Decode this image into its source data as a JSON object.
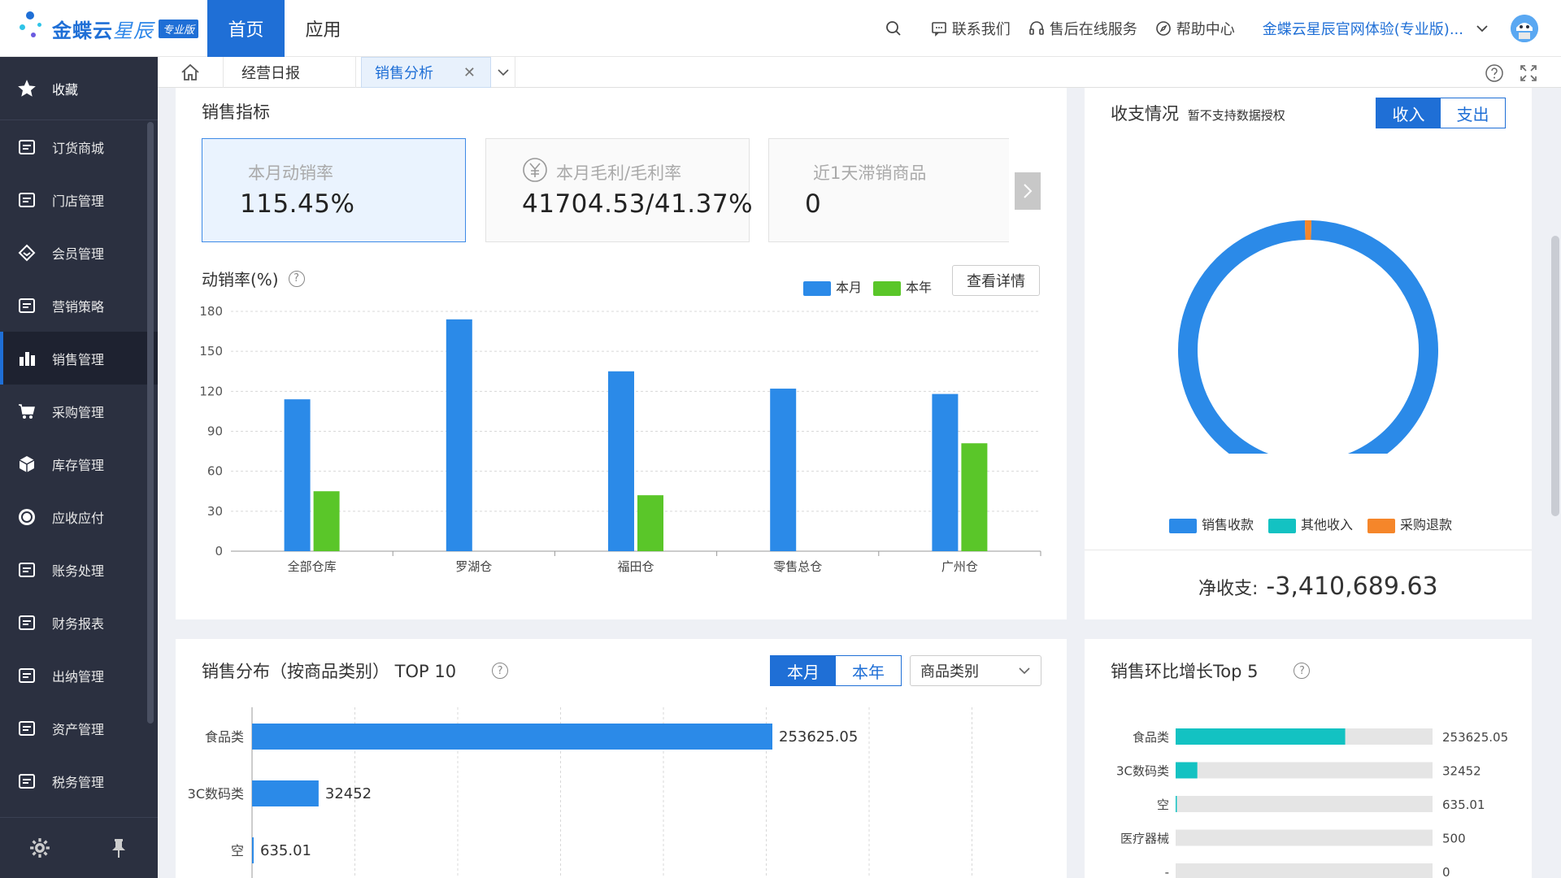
{
  "topbar": {
    "brand_text": "金蝶云",
    "brand_star": "星辰",
    "brand_badge": "专业版",
    "nav": [
      {
        "label": "首页"
      },
      {
        "label": "应用"
      }
    ],
    "contact": "联系我们",
    "after_sales": "售后在线服务",
    "help_center": "帮助中心",
    "account": "金蝶云星辰官网体验(专业版)..."
  },
  "sidebar": {
    "favorites": "收藏",
    "items": [
      {
        "label": "订货商城",
        "icon": "cart-bag-icon"
      },
      {
        "label": "门店管理",
        "icon": "store-icon"
      },
      {
        "label": "会员管理",
        "icon": "diamond-icon"
      },
      {
        "label": "营销策略",
        "icon": "tag-icon"
      },
      {
        "label": "销售管理",
        "icon": "bar-chart-icon"
      },
      {
        "label": "采购管理",
        "icon": "shopping-cart-icon"
      },
      {
        "label": "库存管理",
        "icon": "box-icon"
      },
      {
        "label": "应收应付",
        "icon": "coin-icon"
      },
      {
        "label": "账务处理",
        "icon": "ledger-icon"
      },
      {
        "label": "财务报表",
        "icon": "report-icon"
      },
      {
        "label": "出纳管理",
        "icon": "cashier-icon"
      },
      {
        "label": "资产管理",
        "icon": "asset-icon"
      },
      {
        "label": "税务管理",
        "icon": "tax-icon"
      }
    ],
    "active_index": 4
  },
  "tabs": {
    "items": [
      {
        "label": "经营日报"
      },
      {
        "label": "销售分析"
      }
    ],
    "active": "销售分析"
  },
  "sales_indicators": {
    "title": "销售指标",
    "kpis": [
      {
        "label": "本月动销率",
        "value": "115.45%",
        "selected": true
      },
      {
        "label": "本月毛利/毛利率",
        "value": "41704.53/41.37%",
        "icon": "yuan-icon"
      },
      {
        "label": "近1天滞销商品",
        "value": "0"
      }
    ],
    "turnover_chart_title": "动销率(%)",
    "legend": [
      "本月",
      "本年"
    ],
    "detail_button": "查看详情"
  },
  "colors": {
    "primary": "#1f6fd6",
    "blue_bar": "#2b8ae8",
    "green_bar": "#5ac629",
    "teal": "#13c2c2",
    "orange": "#f5862a"
  },
  "income_expense": {
    "title": "收支情况",
    "note": "暂不支持数据授权",
    "toggle": [
      "收入",
      "支出"
    ],
    "active_toggle": "收入",
    "legend": [
      "销售收款",
      "其他收入",
      "采购退款"
    ],
    "net_label": "净收支:",
    "net_value": "-3,410,689.63"
  },
  "sales_distribution": {
    "title": "销售分布（按商品类别） TOP 10",
    "toggle": [
      "本月",
      "本年"
    ],
    "active_toggle": "本月",
    "select_value": "商品类别"
  },
  "growth_top5": {
    "title": "销售环比增长Top 5"
  },
  "chart_data": [
    {
      "type": "bar",
      "title": "动销率(%)",
      "categories": [
        "全部仓库",
        "罗湖仓",
        "福田仓",
        "零售总仓",
        "广州仓"
      ],
      "series": [
        {
          "name": "本月",
          "values": [
            114,
            174,
            135,
            122,
            118
          ]
        },
        {
          "name": "本年",
          "values": [
            45,
            0,
            42,
            0,
            81
          ]
        }
      ],
      "ylim": [
        0,
        180
      ],
      "yticks": [
        0,
        30,
        60,
        90,
        120,
        150,
        180
      ],
      "grid": true,
      "legend_position": "top-right"
    },
    {
      "type": "pie",
      "title": "收支情况",
      "labels": [
        "销售收款",
        "其他收入",
        "采购退款"
      ],
      "values": [
        99.2,
        0,
        0.8
      ],
      "donut": true
    },
    {
      "type": "bar",
      "orientation": "horizontal",
      "title": "销售分布（按商品类别） TOP 10",
      "categories": [
        "食品类",
        "3C数码类",
        "空"
      ],
      "values": [
        253625.05,
        32452,
        635.01
      ],
      "value_labels": [
        "253625.05",
        "32452",
        "635.01"
      ],
      "grid": true
    },
    {
      "type": "bar",
      "orientation": "horizontal",
      "title": "销售环比增长Top 5",
      "categories": [
        "食品类",
        "3C数码类",
        "空",
        "医疗器械",
        "-"
      ],
      "values": [
        253625.05,
        32452,
        635.01,
        500,
        0
      ],
      "value_labels": [
        "253625.05",
        "32452",
        "635.01",
        "500",
        "0"
      ]
    }
  ]
}
